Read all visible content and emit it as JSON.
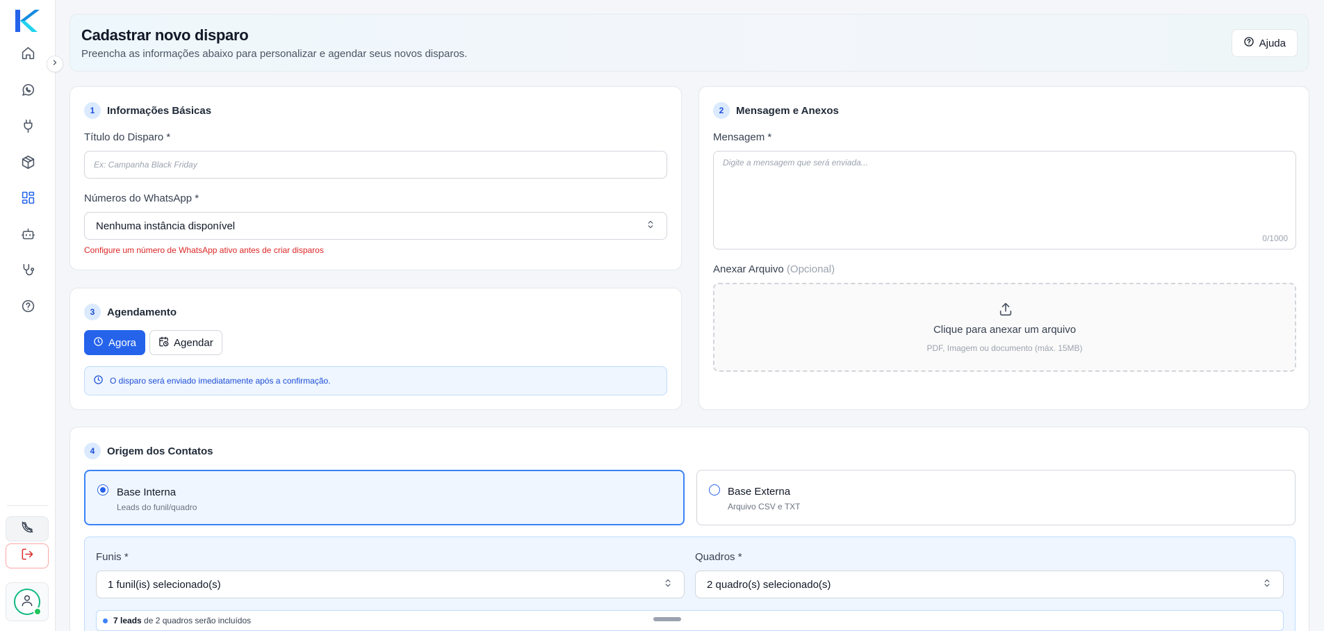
{
  "header": {
    "title": "Cadastrar novo disparo",
    "subtitle": "Preencha as informações abaixo para personalizar e agendar seus novos disparos.",
    "help_label": "Ajuda"
  },
  "sidebar": {
    "items": [
      {
        "icon": "home-icon",
        "active": false
      },
      {
        "icon": "whatsapp-icon",
        "active": false
      },
      {
        "icon": "plug-icon",
        "active": false
      },
      {
        "icon": "package-icon",
        "active": false
      },
      {
        "icon": "dashboard-icon",
        "active": true
      },
      {
        "icon": "bot-icon",
        "active": false
      },
      {
        "icon": "stethoscope-icon",
        "active": false
      },
      {
        "icon": "help-circle-icon",
        "active": false
      }
    ],
    "bottom": [
      "phone-off-icon",
      "logout-icon",
      "user-icon"
    ],
    "online": true
  },
  "basic_info": {
    "step": "1",
    "title": "Informações Básicas",
    "dispatch_title_label": "Título do Disparo *",
    "dispatch_title_placeholder": "Ex: Campanha Black Friday",
    "whatsapp_label": "Números do WhatsApp *",
    "whatsapp_value": "Nenhuma instância disponível",
    "whatsapp_error": "Configure um número de WhatsApp ativo antes de criar disparos"
  },
  "message": {
    "step": "2",
    "title": "Mensagem e Anexos",
    "message_label": "Mensagem *",
    "message_placeholder": "Digite a mensagem que será enviada...",
    "char_count": "0/1000",
    "attach_label": "Anexar Arquivo",
    "attach_optional": "(Opcional)",
    "dropzone_title": "Clique para anexar um arquivo",
    "dropzone_sub": "PDF, Imagem ou documento (máx. 15MB)"
  },
  "schedule": {
    "step": "3",
    "title": "Agendamento",
    "now_label": "Agora",
    "schedule_label": "Agendar",
    "selected": "now",
    "info": "O disparo será enviado imediatamente após a confirmação."
  },
  "contacts": {
    "step": "4",
    "title": "Origem dos Contatos",
    "selected": "internal",
    "internal": {
      "title": "Base Interna",
      "desc": "Leads do funil/quadro"
    },
    "external": {
      "title": "Base Externa",
      "desc": "Arquivo CSV e TXT"
    },
    "funnels_label": "Funis *",
    "funnels_value": "1 funil(is) selecionado(s)",
    "boards_label": "Quadros *",
    "boards_value": "2 quadro(s) selecionado(s)",
    "leads_count": "7 leads",
    "leads_suffix": "de 2 quadros serão incluídos"
  },
  "colors": {
    "primary": "#2563eb",
    "error": "#dc2626",
    "accent_logo_a": "#06b6d4",
    "accent_logo_b": "#2563eb",
    "online": "#22c55e"
  }
}
